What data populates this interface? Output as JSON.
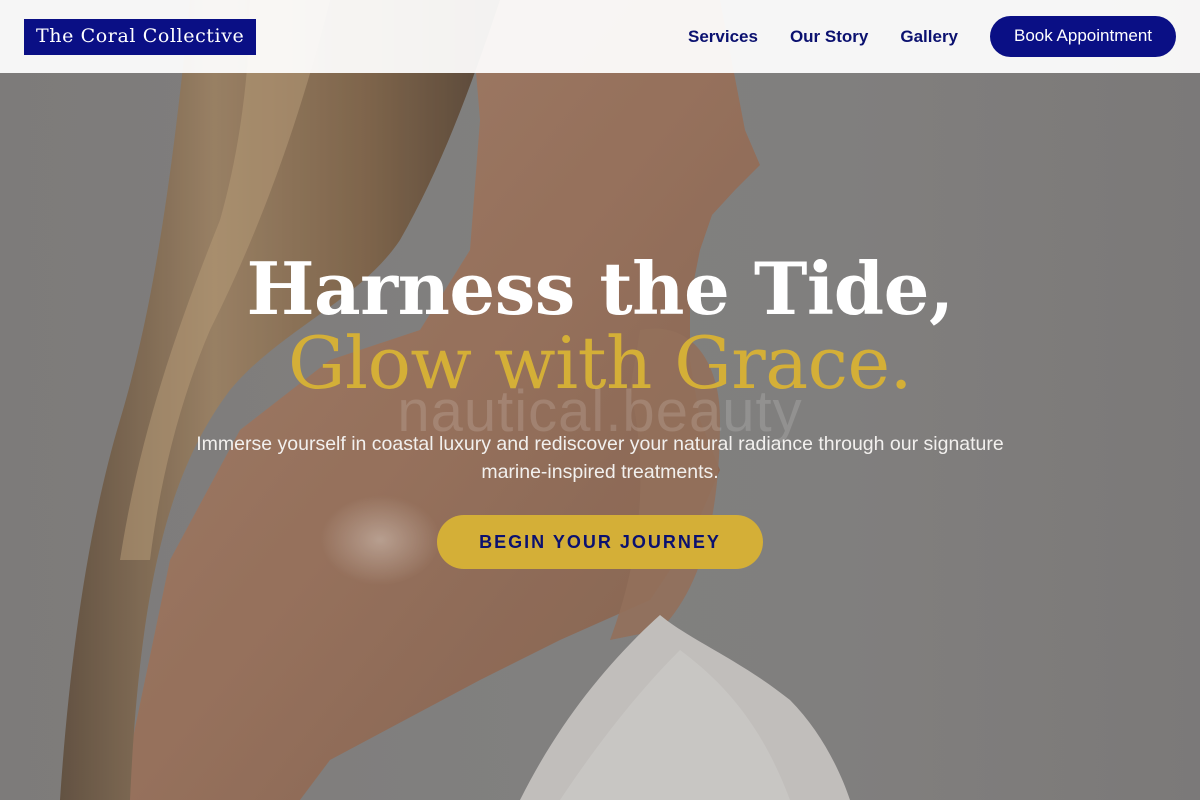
{
  "header": {
    "logo_text": "The Coral Collective",
    "nav": {
      "services": "Services",
      "our_story": "Our Story",
      "gallery": "Gallery"
    },
    "book_button": "Book Appointment"
  },
  "hero": {
    "headline_line1": "Harness the Tide,",
    "headline_line2": "Glow with Grace.",
    "watermark": "nautical.beauty",
    "subtitle": "Immerse yourself in coastal luxury and rediscover your natural radiance through our signature marine-inspired treatments.",
    "cta_label": "BEGIN YOUR JOURNEY"
  },
  "colors": {
    "navy": "#0a0f85",
    "gold": "#d4af37",
    "header_bg": "#ffffff"
  }
}
